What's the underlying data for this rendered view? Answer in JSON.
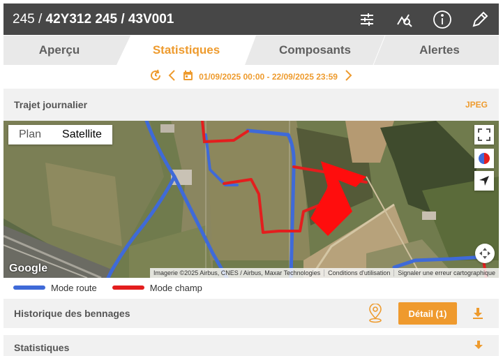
{
  "header": {
    "title_prefix": "245 / ",
    "title_main": "42Y312 245 / 43V001",
    "icons": [
      "sliders-icon",
      "no-signal-icon",
      "info-icon",
      "pencil-icon"
    ]
  },
  "tabs": [
    {
      "label": "Aperçu",
      "active": false
    },
    {
      "label": "Statistiques",
      "active": true
    },
    {
      "label": "Composants",
      "active": false
    },
    {
      "label": "Alertes",
      "active": false
    }
  ],
  "date_range": "01/09/2025 00:00 - 22/09/2025 23:59",
  "trajet": {
    "title": "Trajet journalier",
    "export_label": "JPEG"
  },
  "map": {
    "type_plan": "Plan",
    "type_satellite": "Satellite",
    "selected_type": "Satellite",
    "google_logo": "Google",
    "attribution": [
      "Imagerie ©2025 Airbus, CNES / Airbus, Maxar Technologies",
      "Conditions d'utilisation",
      "Signaler une erreur cartographique"
    ]
  },
  "legend": [
    {
      "label": "Mode route",
      "color": "#3f6ad8"
    },
    {
      "label": "Mode champ",
      "color": "#e31e1e"
    }
  ],
  "historique": {
    "title": "Historique des bennages",
    "detail_label": "Détail (1)"
  },
  "statistiques": {
    "title": "Statistiques"
  },
  "colors": {
    "accent": "#ee9b2e",
    "header": "#474747",
    "route": "#3f6ad8",
    "champ": "#e31e1e"
  }
}
